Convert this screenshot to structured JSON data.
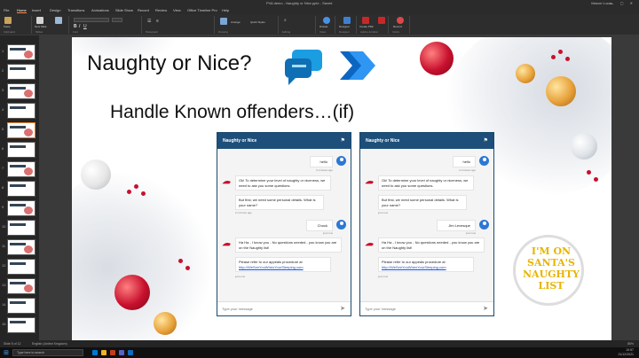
{
  "window": {
    "title": "PVA demo - Naughty or Nice.pptx - Saved",
    "user": "Mason Lucas",
    "controls": "— ▢ ✕"
  },
  "ribbon_tabs": [
    "File",
    "Home",
    "Insert",
    "Design",
    "Transitions",
    "Animations",
    "Slide Show",
    "Record",
    "Review",
    "View",
    "Office Timeline Pro",
    "Help"
  ],
  "ribbon": {
    "groups": [
      "Clipboard",
      "Slides",
      "Font",
      "Paragraph",
      "Drawing",
      "Editing",
      "Voice",
      "Designer",
      "Adobe Acrobat",
      "Clicks"
    ],
    "buttons": [
      "Paste",
      "New Slide",
      "Reuse Slides",
      "Arrange",
      "Quick Styles",
      "Dictate",
      "Designer",
      "Create PDF",
      "Share Link",
      "Record"
    ]
  },
  "slide": {
    "title": "Naughty or Nice?",
    "subtitle": "Handle Known offenders…(if)"
  },
  "chat_left": {
    "header": "Naughty or Nice",
    "messages": {
      "u1": "hello",
      "t1": "2 minutes ago",
      "b1": "Ok! To determine your level of naughty or niceness, we need to ask you some questions.",
      "b2": "But first, we need some personal details. What is your name?",
      "t2": "2 minutes ago",
      "u2": "Chuck",
      "t3": "just now",
      "b3": "Ha Ha - I know you - No questions needed - you know you are on the Naughty list!",
      "b4": "Please refer to our appeals procedure at",
      "link": "http://WeSeeYouWhenYourSleeping.com",
      "t4": "just now"
    },
    "placeholder": "Type your message"
  },
  "chat_right": {
    "header": "Naughty or Nice",
    "messages": {
      "u1": "hello",
      "t1": "2 minutes ago",
      "b1": "Ok! To determine your level of naughty or niceness, we need to ask you some questions.",
      "b2": "But first, we need some personal details. What is your name?",
      "t2": "just now",
      "u2": "Jim Levesque",
      "t3": "just now",
      "b3": "Ha Ha - I know you - No questions needed - you know you are on the Naughty list!",
      "b4": "Please refer to our appeals procedure at",
      "link": "http://WeSeeYouWhenYourSleeping.com",
      "t4": "just now"
    },
    "placeholder": "Type your message"
  },
  "badge": {
    "l1": "I'M ON",
    "l2": "SANTA'S",
    "l3": "NAUGHTY",
    "l4": "LIST"
  },
  "status": {
    "slide": "Slide 5 of 12",
    "lang": "English (United Kingdom)",
    "zoom": "86%"
  },
  "taskbar": {
    "search": "Type here to search",
    "time": "10:57",
    "date": "21/12/2021"
  },
  "colors": {
    "chat_header": "#1e4f7a",
    "user_avatar": "#2b78d4",
    "accent": "#e87b2a"
  }
}
